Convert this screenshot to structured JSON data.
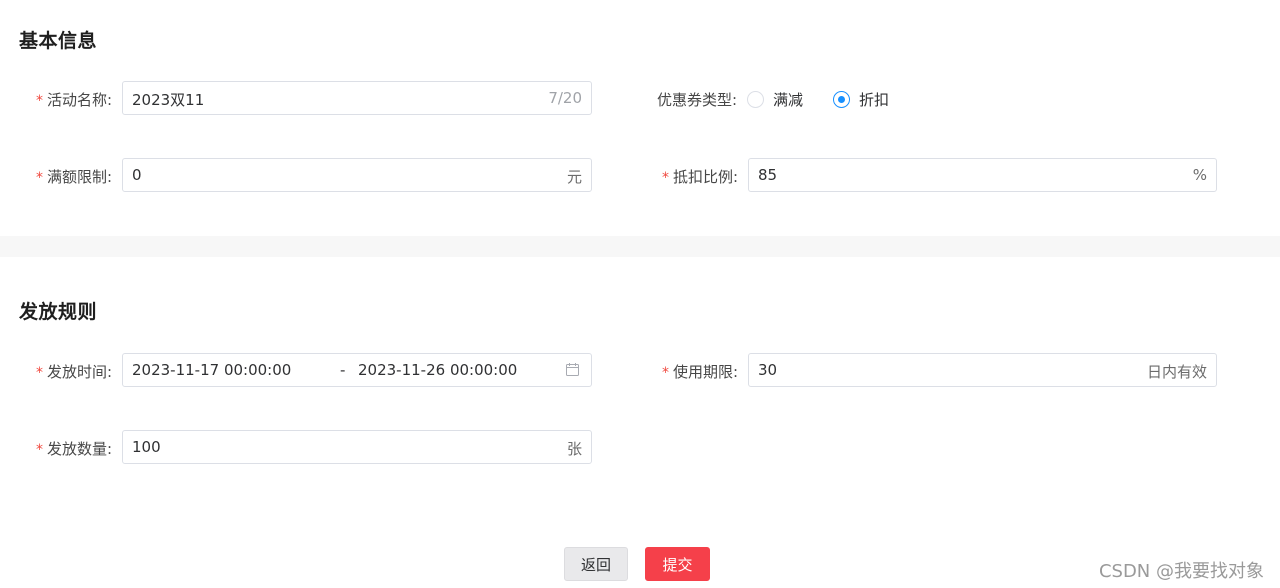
{
  "basic_info": {
    "title": "基本信息",
    "activity_name": {
      "required_mark": "*",
      "label": "活动名称:",
      "value": "2023双11",
      "counter": "7/20"
    },
    "coupon_type": {
      "label": "优惠券类型:",
      "options": [
        {
          "label": "满减",
          "checked": false
        },
        {
          "label": "折扣",
          "checked": true
        }
      ]
    },
    "threshold": {
      "required_mark": "*",
      "label": "满额限制:",
      "value": "0",
      "suffix": "元"
    },
    "discount_ratio": {
      "required_mark": "*",
      "label": "抵扣比例:",
      "value": "85",
      "suffix": "%"
    }
  },
  "issue_rules": {
    "title": "发放规则",
    "issue_time": {
      "required_mark": "*",
      "label": "发放时间:",
      "start": "2023-11-17 00:00:00",
      "separator": "-",
      "end": "2023-11-26 00:00:00",
      "icon": "calendar-icon"
    },
    "validity": {
      "required_mark": "*",
      "label": "使用期限:",
      "value": "30",
      "suffix": "日内有效"
    },
    "quantity": {
      "required_mark": "*",
      "label": "发放数量:",
      "value": "100",
      "suffix": "张"
    }
  },
  "actions": {
    "back_label": "返回",
    "submit_label": "提交"
  },
  "watermark": "CSDN @我要找对象",
  "colors": {
    "primary": "#1890ff",
    "required": "#f0483e",
    "submit": "#f5404a",
    "divider": "#f7f7f7"
  }
}
